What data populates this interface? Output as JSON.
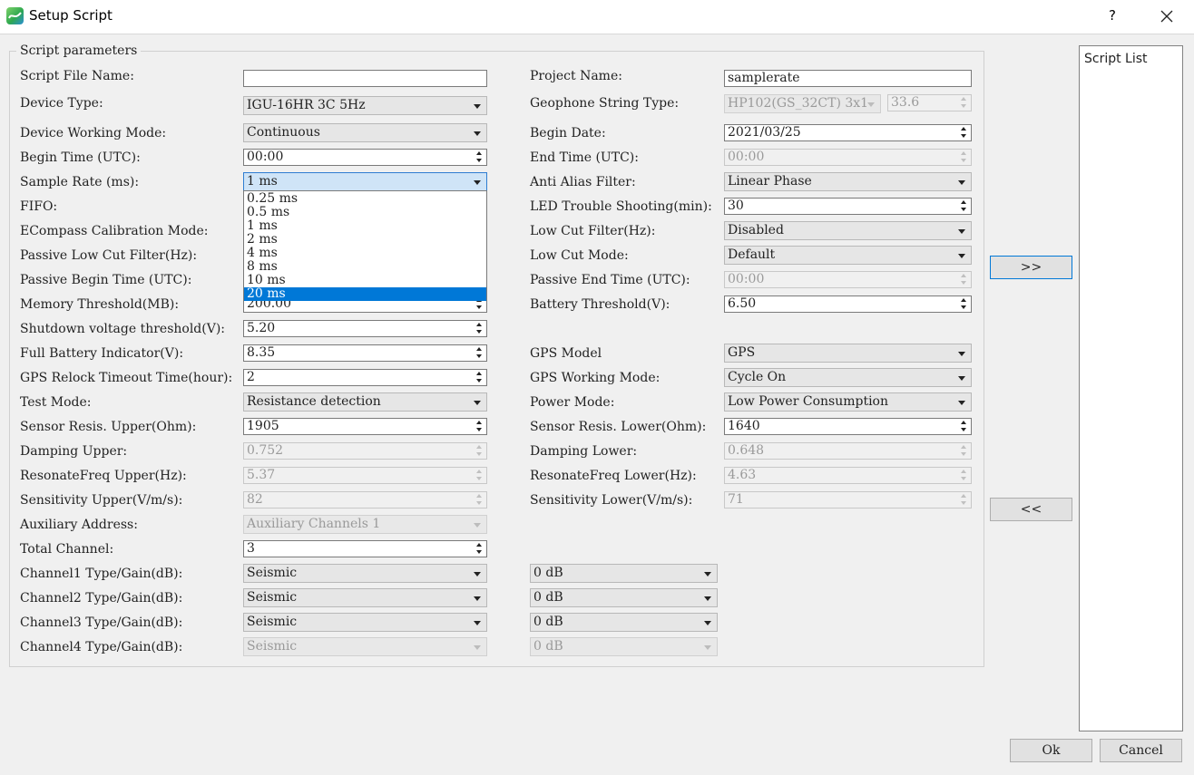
{
  "window": {
    "title": "Setup Script",
    "help": "?"
  },
  "group_title": "Script parameters",
  "left_labels": {
    "script_file_name": "Script File Name:",
    "device_type": "Device Type:",
    "device_working_mode": "Device Working Mode:",
    "begin_time": "Begin Time (UTC):",
    "sample_rate": "Sample Rate (ms):",
    "fifo": "FIFO:",
    "ecompass": "ECompass Calibration Mode:",
    "passive_low_cut": "Passive Low Cut Filter(Hz):",
    "passive_begin": "Passive Begin Time (UTC):",
    "memory_threshold": "Memory Threshold(MB):",
    "shutdown_voltage": "Shutdown voltage threshold(V):",
    "full_battery": "Full Battery Indicator(V):",
    "gps_relock": "GPS Relock Timeout Time(hour):",
    "test_mode": "Test Mode:",
    "sensor_upper": "Sensor Resis. Upper(Ohm):",
    "damping_upper": "Damping Upper:",
    "resonate_upper": "ResonateFreq Upper(Hz):",
    "sensitivity_upper": "Sensitivity Upper(V/m/s):",
    "aux_address": "Auxiliary Address:",
    "total_channel": "Total Channel:",
    "ch1": "Channel1 Type/Gain(dB):",
    "ch2": "Channel2 Type/Gain(dB):",
    "ch3": "Channel3 Type/Gain(dB):",
    "ch4": "Channel4 Type/Gain(dB):"
  },
  "left_values": {
    "script_file_name": "",
    "device_type": "IGU-16HR 3C 5Hz",
    "device_working_mode": "Continuous",
    "begin_time": "00:00",
    "sample_rate": "1 ms",
    "memory_threshold": "200.00",
    "shutdown_voltage": "5.20",
    "full_battery": "8.35",
    "gps_relock": "2",
    "test_mode": "Resistance detection",
    "sensor_upper": "1905",
    "damping_upper": "0.752",
    "resonate_upper": "5.37",
    "sensitivity_upper": "82",
    "aux_address": "Auxiliary Channels 1",
    "total_channel": "3",
    "ch1_type": "Seismic",
    "ch2_type": "Seismic",
    "ch3_type": "Seismic",
    "ch4_type": "Seismic",
    "ch1_gain": "0 dB",
    "ch2_gain": "0 dB",
    "ch3_gain": "0 dB",
    "ch4_gain": "0 dB"
  },
  "sample_rate_options": [
    "0.25 ms",
    "0.5 ms",
    "1 ms",
    "2 ms",
    "4 ms",
    "8 ms",
    "10 ms",
    "20 ms"
  ],
  "sample_rate_highlighted": "20 ms",
  "right_labels": {
    "project_name": "Project Name:",
    "geophone": "Geophone String Type:",
    "begin_date": "Begin Date:",
    "end_time": "End Time (UTC):",
    "anti_alias": "Anti Alias Filter:",
    "led": "LED Trouble Shooting(min):",
    "low_cut_filter": "Low Cut Filter(Hz):",
    "low_cut_mode": "Low Cut Mode:",
    "passive_end": "Passive End Time (UTC):",
    "battery_threshold": "Battery Threshold(V):",
    "gps_model": "GPS Model",
    "gps_working": "GPS Working Mode:",
    "power_mode": "Power Mode:",
    "sensor_lower": "Sensor Resis. Lower(Ohm):",
    "damping_lower": "Damping Lower:",
    "resonate_lower": "ResonateFreq Lower(Hz):",
    "sensitivity_lower": "Sensitivity Lower(V/m/s):"
  },
  "right_values": {
    "project_name": "samplerate",
    "geophone_type": "HP102(GS_32CT) 3x1",
    "geophone_value": "33.6",
    "begin_date": "2021/03/25",
    "end_time": "00:00",
    "anti_alias": "Linear Phase",
    "led": "30",
    "low_cut_filter": "Disabled",
    "low_cut_mode": "Default",
    "passive_end": "00:00",
    "battery_threshold": "6.50",
    "gps_model": "GPS",
    "gps_working": "Cycle On",
    "power_mode": "Low Power Consumption",
    "sensor_lower": "1640",
    "damping_lower": "0.648",
    "resonate_lower": "4.63",
    "sensitivity_lower": "71"
  },
  "buttons": {
    "add": ">>",
    "remove": "<<",
    "ok": "Ok",
    "cancel": "Cancel"
  },
  "script_list_title": "Script List"
}
